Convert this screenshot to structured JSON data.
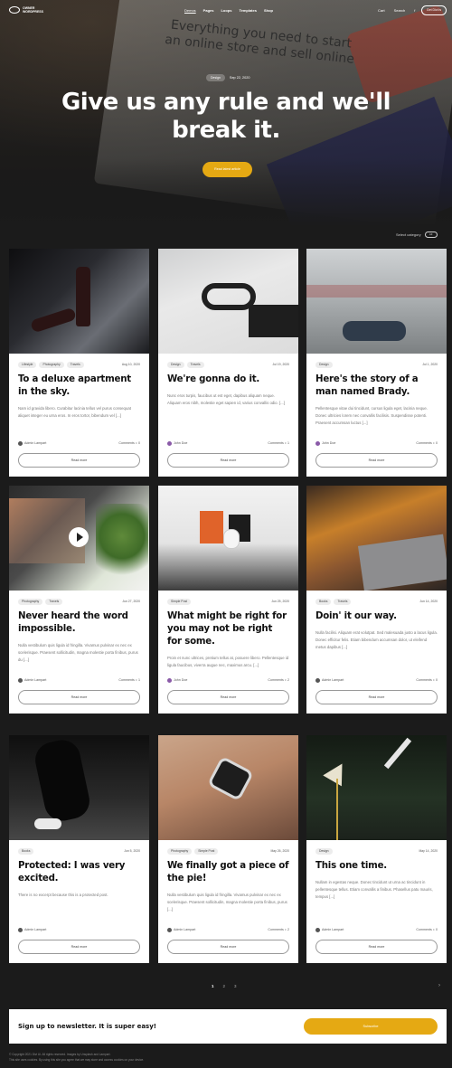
{
  "nav": {
    "logo_line1": "OWNER",
    "logo_line2": "WORDPRESS",
    "menu": [
      "Demos",
      "Pages",
      "Loops",
      "Templates",
      "Shop"
    ],
    "cart": "Cart",
    "search": "Search",
    "facebook": "f",
    "cta": "Get Divi.ts"
  },
  "hero": {
    "screen_text": "Everything you need to start an online store and sell online",
    "tag": "Design",
    "date": "Sep 22, 2020",
    "title": "Give us any rule and we'll break it.",
    "button": "Read latest article"
  },
  "filter": {
    "label": "Select category",
    "pill": "All"
  },
  "cards": [
    {
      "tags": [
        "Lifestyle",
        "Photography",
        "Travels"
      ],
      "date": "Aug 10, 2020",
      "title": "To a deluxe apartment in the sky.",
      "excerpt": "Nam id gravida libero. Curabitur lacinia tellus vel purus consequat aliquet integer eu urna eros. In eros tortor, bibendum vel [...]",
      "author": "Admin Lampart",
      "comments": "Comments ∘ 0",
      "read_more": "Read more"
    },
    {
      "tags": [
        "Design",
        "Travels"
      ],
      "date": "Jul 19, 2020",
      "title": "We're gonna do it.",
      "excerpt": "Nunc eros turpis, faucibus ut est eget, dapibus aliquam neque. Aliquam eros nibh, molestie eget sapien id, varius convallis odio. [...]",
      "author": "John Doe",
      "comments": "Comments ∘ 1",
      "read_more": "Read more"
    },
    {
      "tags": [
        "Design"
      ],
      "date": "Jul 1, 2020",
      "title": "Here's the story of a man named Brady.",
      "excerpt": "Pellentesque vitae dui tincidunt, cursus ligula eget, lacinia neque. Donec ultricies lorem nec convallis facilisis. Suspendisse potenti. Praesent accumsan luctus [...]",
      "author": "John Doe",
      "comments": "Comments ∘ 0",
      "read_more": "Read more"
    },
    {
      "tags": [
        "Photography",
        "Travels"
      ],
      "date": "Jun 27, 2020",
      "title": "Never heard the word impossible.",
      "excerpt": "Nulla vestibulum quis ligula id fringilla. Vivamus pulvinar ex nec ex scelerisque. Praesent sollicitudin, magna molestie porta finibus, purus du [...]",
      "author": "Admin Lampart",
      "comments": "Comments ∘ 1",
      "read_more": "Read more"
    },
    {
      "tags": [
        "Simple Post"
      ],
      "date": "Jun 25, 2020",
      "title": "What might be right for you may not be right for some.",
      "excerpt": "Proin et nunc ultrices, pretium tellus at, posuere libero. Pellentesque id ligula faucibus, viverra augue nec, maximus arcu. [...]",
      "author": "John Doe",
      "comments": "Comments ∘ 2",
      "read_more": "Read more"
    },
    {
      "tags": [
        "Books",
        "Travels"
      ],
      "date": "Jun 14, 2020",
      "title": "Doin' it our way.",
      "excerpt": "Nulla facilisi. Aliquam erat volutpat. Sed malesuada justo a lacus ligula. Donec efficitur felis. Etiam bibendum accumsan dolor, ut eleifend metus dapibus [...]",
      "author": "Admin Lampart",
      "comments": "Comments ∘ 0",
      "read_more": "Read more"
    },
    {
      "tags": [
        "Books"
      ],
      "date": "Jun 5, 2020",
      "title": "Protected: I was very excited.",
      "excerpt": "There is no excerpt because this is a protected post.",
      "author": "Admin Lampart",
      "comments": "",
      "read_more": "Read more"
    },
    {
      "tags": [
        "Photography",
        "Simple Post"
      ],
      "date": "May 26, 2020",
      "title": "We finally got a piece of the pie!",
      "excerpt": "Nulla vestibulum quis ligula id fringilla. Vivamus pulvinar ex nec ex scelerisque. Praesent sollicitudin, magna molestie porta finibus, purus [...]",
      "author": "Admin Lampart",
      "comments": "Comments ∘ 2",
      "read_more": "Read more"
    },
    {
      "tags": [
        "Design"
      ],
      "date": "May 14, 2020",
      "title": "This one time.",
      "excerpt": "Nullam in egestas neque. Donec tincidunt ut urna ac tincidunt in pellentesque tellus. Etiam convallis a finibus. Phasellus patu mauris, tempus [...]",
      "author": "Admin Lampart",
      "comments": "Comments ∘ 0",
      "read_more": "Read more"
    }
  ],
  "pagination": {
    "pages": [
      "1",
      "2",
      "3"
    ],
    "next": "›"
  },
  "newsletter": {
    "text": "Sign up to newsletter. It is super easy!",
    "button": "Subscribe"
  },
  "footer": {
    "line1": "© Copyright 2021 Divi Ui. All rights reserved. Images by Unsplash and Lampart.",
    "line2": "This site uses cookies. By using this site you agree that we may store and access cookies on your device."
  },
  "colors": {
    "accent": "#e5a913",
    "page_bg": "#1b1b1b",
    "card_bg": "#ffffff"
  }
}
